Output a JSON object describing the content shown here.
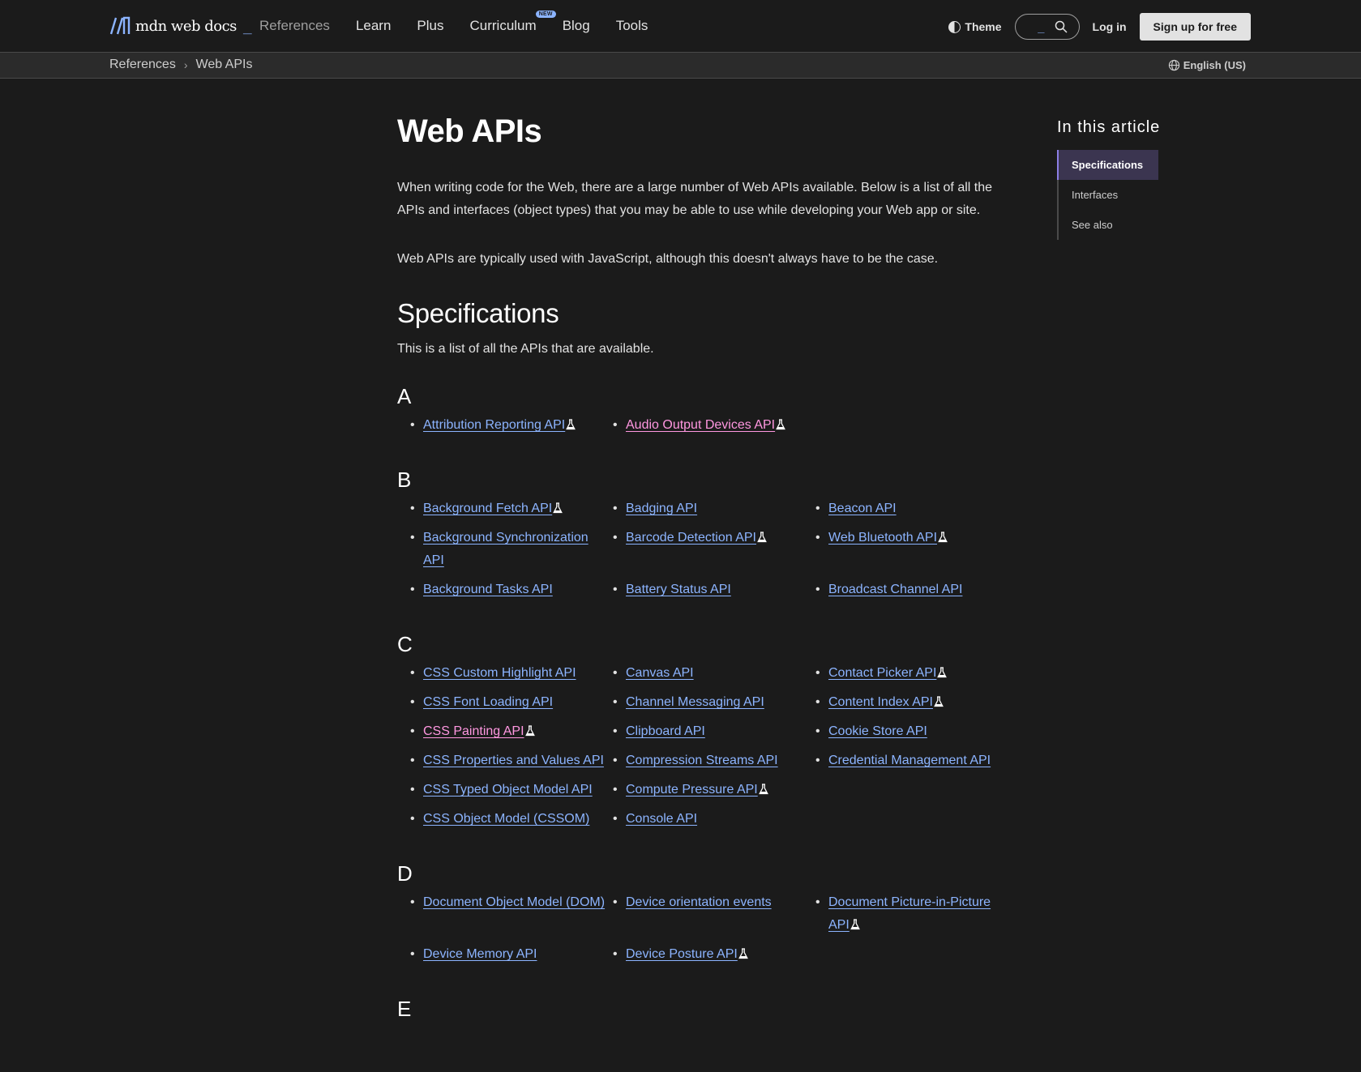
{
  "header": {
    "logo_text": "mdn web docs",
    "logo_cursor": "_",
    "nav": [
      {
        "label": "References",
        "dim": true
      },
      {
        "label": "Learn"
      },
      {
        "label": "Plus"
      },
      {
        "label": "Curriculum",
        "badge": "NEW"
      },
      {
        "label": "Blog"
      },
      {
        "label": "Tools"
      }
    ],
    "theme_label": "Theme",
    "search_cursor": "_",
    "login_label": "Log in",
    "signup_label": "Sign up for free"
  },
  "breadcrumb": {
    "items": [
      "References",
      "Web APIs"
    ],
    "language": "English (US)"
  },
  "main": {
    "title": "Web APIs",
    "intro": "When writing code for the Web, there are a large number of Web APIs available. Below is a list of all the APIs and interfaces (object types) that you may be able to use while developing your Web app or site.",
    "intro2": "Web APIs are typically used with JavaScript, although this doesn't always have to be the case.",
    "spec_heading": "Specifications",
    "spec_desc": "This is a list of all the APIs that are available.",
    "groups": [
      {
        "letter": "A",
        "rows": 1,
        "apis": [
          {
            "label": "Attribution Reporting API",
            "experimental": true
          },
          {
            "label": "Audio Output Devices API",
            "experimental": true,
            "visited": true
          }
        ]
      },
      {
        "letter": "B",
        "rows": 3,
        "apis": [
          {
            "label": "Background Fetch API",
            "experimental": true
          },
          {
            "label": "Background Synchronization API"
          },
          {
            "label": "Background Tasks API"
          },
          {
            "label": "Badging API"
          },
          {
            "label": "Barcode Detection API",
            "experimental": true
          },
          {
            "label": "Battery Status API"
          },
          {
            "label": "Beacon API"
          },
          {
            "label": "Web Bluetooth API",
            "experimental": true
          },
          {
            "label": "Broadcast Channel API"
          }
        ]
      },
      {
        "letter": "C",
        "rows": 6,
        "apis": [
          {
            "label": "CSS Custom Highlight API"
          },
          {
            "label": "CSS Font Loading API"
          },
          {
            "label": "CSS Painting API",
            "experimental": true,
            "visited": true
          },
          {
            "label": "CSS Properties and Values API"
          },
          {
            "label": "CSS Typed Object Model API"
          },
          {
            "label": "CSS Object Model (CSSOM)"
          },
          {
            "label": "Canvas API"
          },
          {
            "label": "Channel Messaging API"
          },
          {
            "label": "Clipboard API"
          },
          {
            "label": "Compression Streams API"
          },
          {
            "label": "Compute Pressure API",
            "experimental": true
          },
          {
            "label": "Console API"
          },
          {
            "label": "Contact Picker API",
            "experimental": true
          },
          {
            "label": "Content Index API",
            "experimental": true
          },
          {
            "label": "Cookie Store API"
          },
          {
            "label": "Credential Management API"
          }
        ]
      },
      {
        "letter": "D",
        "rows": 2,
        "apis": [
          {
            "label": "Document Object Model (DOM)"
          },
          {
            "label": "Device Memory API"
          },
          {
            "label": "Device orientation events"
          },
          {
            "label": "Device Posture API",
            "experimental": true
          },
          {
            "label": "Document Picture-in-Picture API",
            "experimental": true
          }
        ]
      },
      {
        "letter": "E",
        "rows": 1,
        "apis": []
      }
    ]
  },
  "toc": {
    "title": "In this article",
    "items": [
      {
        "label": "Specifications",
        "active": true
      },
      {
        "label": "Interfaces"
      },
      {
        "label": "See also"
      }
    ]
  },
  "colors": {
    "background": "#1b1b1b",
    "link": "#8cb4ff",
    "visited_link": "#ff97e0",
    "toc_active": "#3b3550"
  }
}
